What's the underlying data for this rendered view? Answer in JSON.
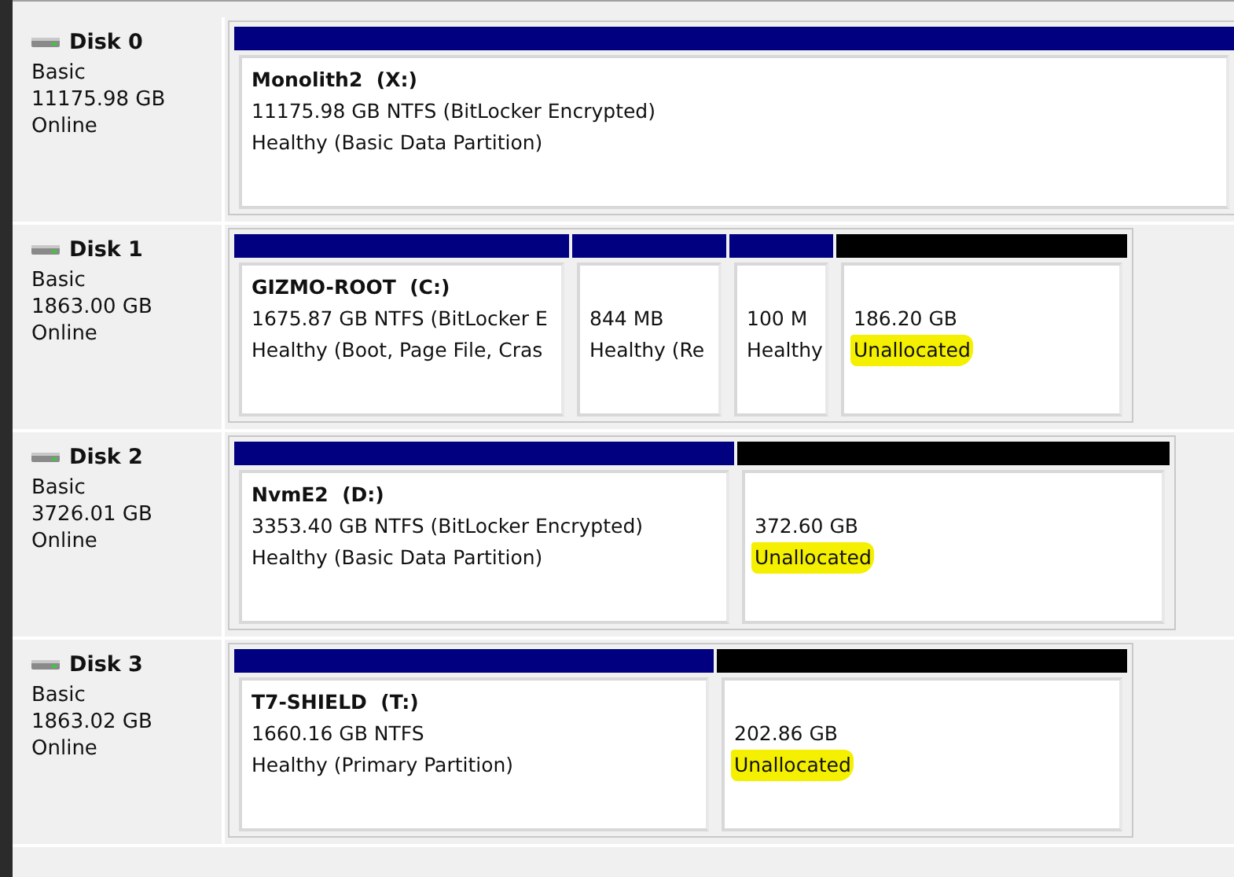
{
  "disks": [
    {
      "name": "Disk 0",
      "type": "Basic",
      "size": "11175.98 GB",
      "status": "Online",
      "partitions": [
        {
          "kind": "primary",
          "title": "Monolith2  (X:)",
          "detail": "11175.98 GB NTFS (BitLocker Encrypted)",
          "health": "Healthy (Basic Data Partition)",
          "highlighted": false
        }
      ]
    },
    {
      "name": "Disk 1",
      "type": "Basic",
      "size": "1863.00 GB",
      "status": "Online",
      "partitions": [
        {
          "kind": "primary",
          "title": "GIZMO-ROOT  (C:)",
          "detail": "1675.87 GB NTFS (BitLocker E",
          "health": "Healthy (Boot, Page File, Cras",
          "highlighted": false
        },
        {
          "kind": "primary",
          "detail": "844 MB",
          "health": "Healthy (Re",
          "highlighted": false
        },
        {
          "kind": "primary",
          "detail": "100 M",
          "health": "Healthy",
          "highlighted": false
        },
        {
          "kind": "unallocated",
          "detail": "186.20 GB",
          "health": "Unallocated",
          "highlighted": true
        }
      ]
    },
    {
      "name": "Disk 2",
      "type": "Basic",
      "size": "3726.01 GB",
      "status": "Online",
      "partitions": [
        {
          "kind": "primary",
          "title": "NvmE2  (D:)",
          "detail": "3353.40 GB NTFS (BitLocker Encrypted)",
          "health": "Healthy (Basic Data Partition)",
          "highlighted": false
        },
        {
          "kind": "unallocated",
          "detail": "372.60 GB",
          "health": "Unallocated",
          "highlighted": true
        }
      ]
    },
    {
      "name": "Disk 3",
      "type": "Basic",
      "size": "1863.02 GB",
      "status": "Online",
      "partitions": [
        {
          "kind": "primary",
          "title": "T7-SHIELD  (T:)",
          "detail": "1660.16 GB NTFS",
          "health": "Healthy (Primary Partition)",
          "highlighted": false
        },
        {
          "kind": "unallocated",
          "detail": "202.86 GB",
          "health": "Unallocated",
          "highlighted": true
        }
      ]
    }
  ]
}
